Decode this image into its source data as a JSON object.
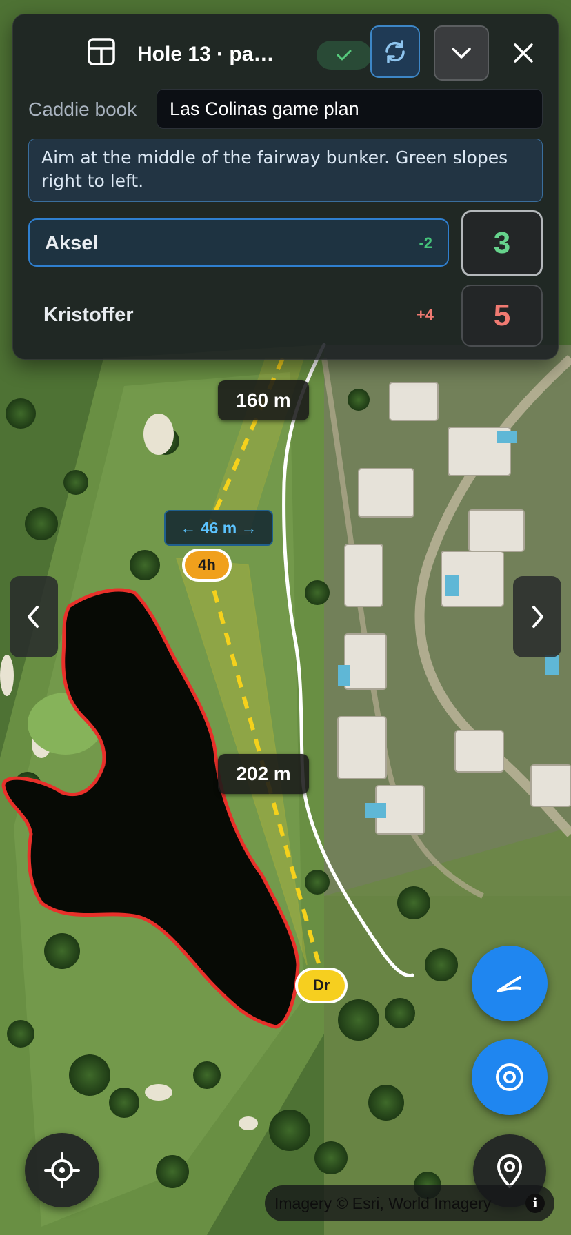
{
  "header": {
    "hole_title": "Hole 13 · pa…",
    "icons": {
      "table": "table-icon",
      "check": "check-icon",
      "sync": "sync-icon",
      "collapse": "chevron-down-icon",
      "close": "close-icon"
    }
  },
  "caddie": {
    "label": "Caddie book",
    "value": "Las Colinas game plan"
  },
  "note": "Aim at the middle of the fairway bunker. Green slopes right to left.",
  "players": [
    {
      "name": "Aksel",
      "diff": "-2",
      "score": "3",
      "active": true
    },
    {
      "name": "Kristoffer",
      "diff": "+4",
      "score": "5",
      "active": false
    }
  ],
  "map": {
    "distance_far": "160 m",
    "distance_near": "202 m",
    "width_label": "← 46 m →",
    "club_far": "4h",
    "club_near": "Dr",
    "attribution": "Imagery © Esri, World Imagery",
    "colors": {
      "hazard_outline": "#e8302a",
      "shot_line": "#f5d11c",
      "accent": "#1f86f0"
    }
  },
  "nav": {
    "prev_icon": "chevron-left-icon",
    "next_icon": "chevron-right-icon"
  },
  "fabs": {
    "draw_icon": "draw-icon",
    "target_icon": "target-icon",
    "pin_icon": "map-pin-icon",
    "locate_icon": "crosshair-icon"
  }
}
